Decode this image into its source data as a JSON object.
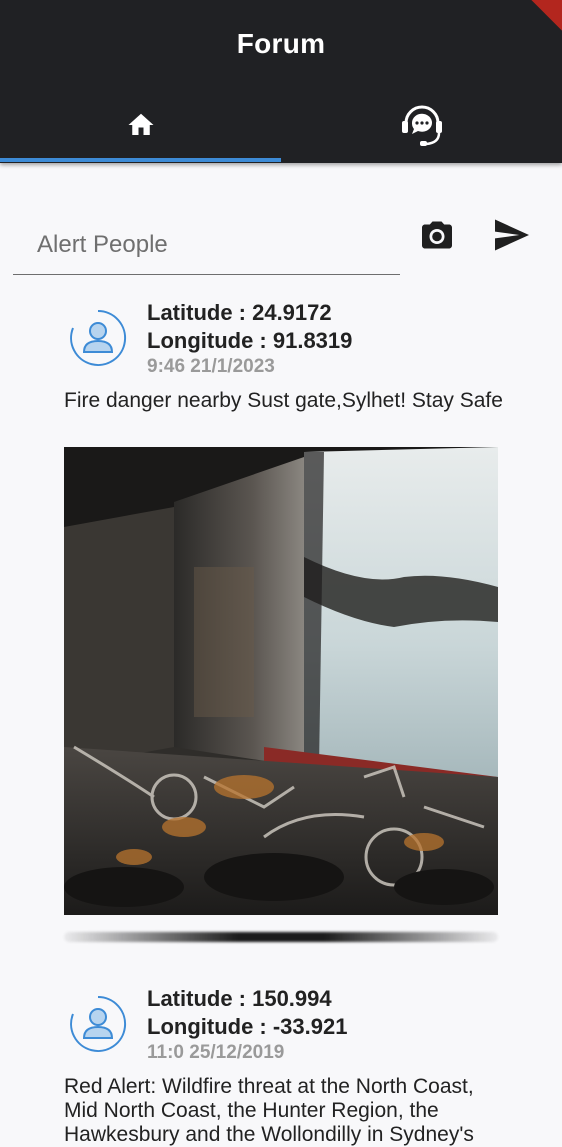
{
  "app": {
    "title": "Forum"
  },
  "tabs": [
    {
      "icon": "home-icon",
      "selected": true
    },
    {
      "icon": "support-chat-icon",
      "selected": false
    }
  ],
  "composer": {
    "placeholder": "Alert People",
    "camera_icon": "camera-icon",
    "send_icon": "send-icon"
  },
  "posts": [
    {
      "latitude": "Latitude : 24.9172",
      "longitude": "Longitude : 91.8319",
      "time": "9:46 21/1/2023",
      "message": "Fire danger nearby Sust gate,Sylhet!  Stay Safe",
      "has_image": true
    },
    {
      "latitude": "Latitude : 150.994",
      "longitude": "Longitude : -33.921",
      "time": "11:0 25/12/2019",
      "message": "Red Alert: Wildfire threat at the North Coast, Mid North Coast, the Hunter Region, the Hawkesbury and the Wollondilly in Sydney's",
      "has_image": false
    }
  ],
  "colors": {
    "appbar": "#202124",
    "indicator": "#3d8bd6",
    "avatar": "#3d8bd6",
    "background": "#f8f8fa"
  }
}
